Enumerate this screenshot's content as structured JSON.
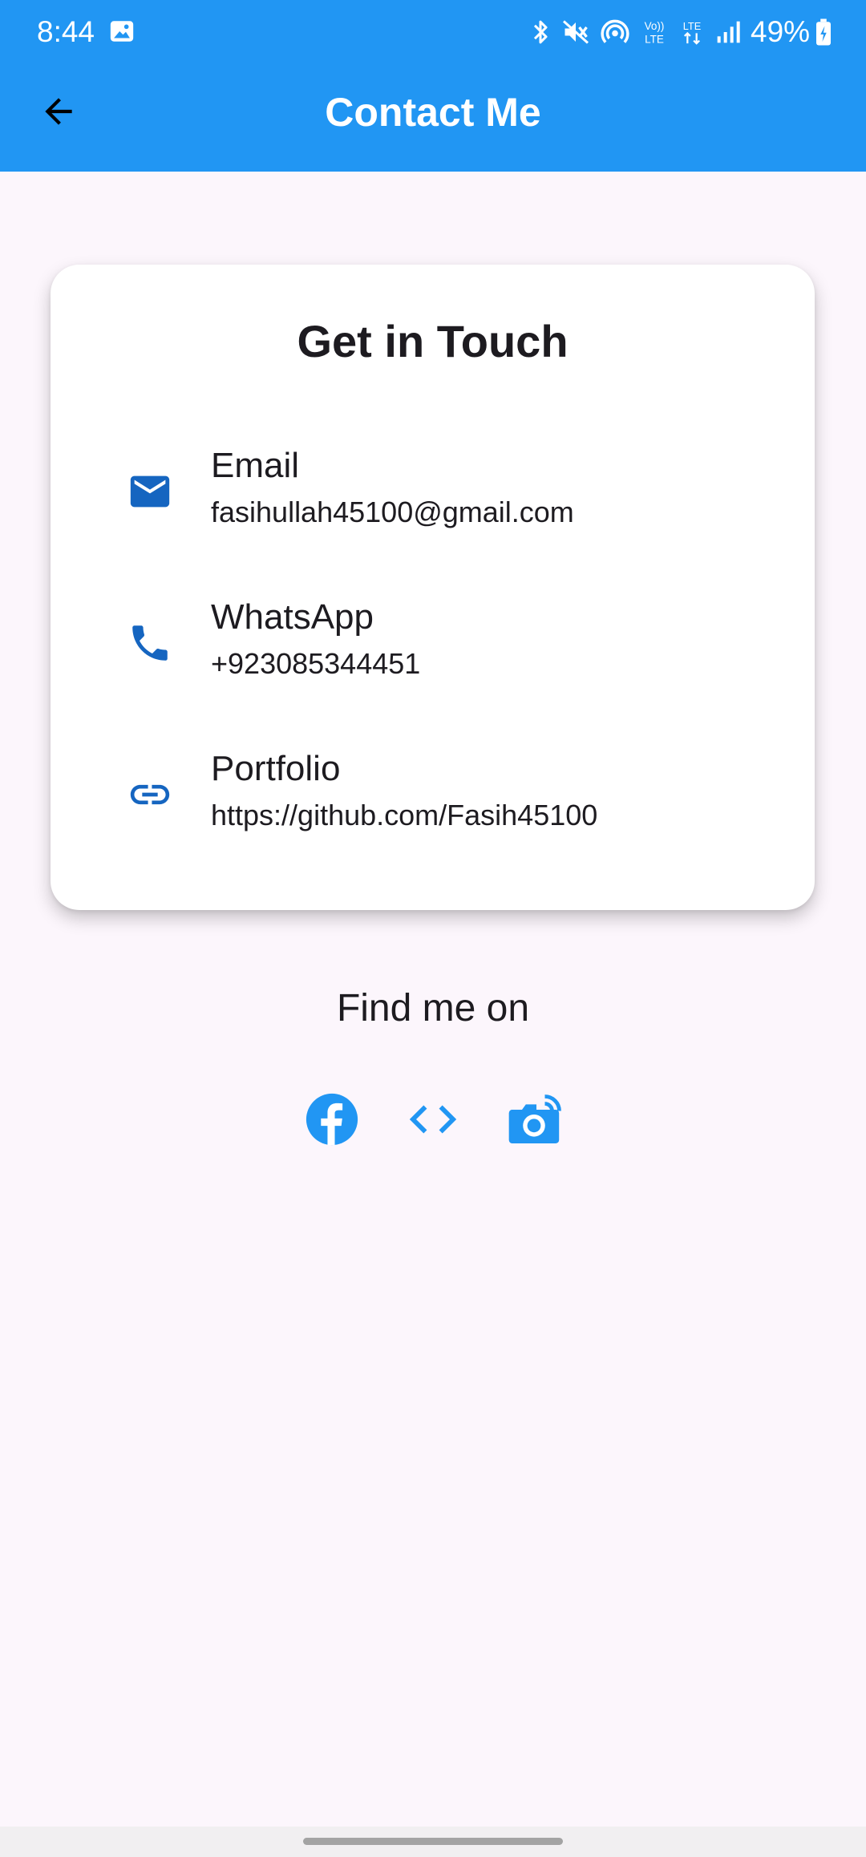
{
  "status_bar": {
    "time": "8:44",
    "battery": "49%",
    "network_labels": [
      "Vo)) LTE",
      "LTE"
    ]
  },
  "app_bar": {
    "title": "Contact Me",
    "background": "#2196f3",
    "back_icon": "arrow-back-icon"
  },
  "card": {
    "title": "Get in Touch",
    "items": [
      {
        "icon": "mail-icon",
        "label": "Email",
        "value": "fasihullah45100@gmail.com"
      },
      {
        "icon": "phone-icon",
        "label": "WhatsApp",
        "value": "+923085344451"
      },
      {
        "icon": "link-icon",
        "label": "Portfolio",
        "value": "https://github.com/Fasih45100"
      }
    ]
  },
  "social": {
    "heading": "Find me on",
    "links": [
      {
        "icon": "facebook-icon"
      },
      {
        "icon": "code-icon"
      },
      {
        "icon": "camera-icon"
      }
    ]
  },
  "colors": {
    "accent": "#2196f3",
    "icon_dark_blue": "#1565c0",
    "background": "#fcf6fc"
  }
}
